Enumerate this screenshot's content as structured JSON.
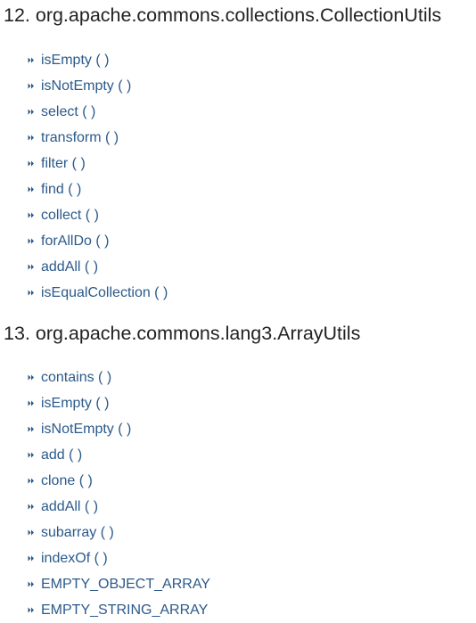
{
  "sections": [
    {
      "title": "12. org.apache.commons.collections.CollectionUtils",
      "items": [
        {
          "label": "isEmpty ( )"
        },
        {
          "label": "isNotEmpty ( )"
        },
        {
          "label": "select ( )"
        },
        {
          "label": "transform ( )"
        },
        {
          "label": "filter ( )"
        },
        {
          "label": "find ( )"
        },
        {
          "label": "collect ( )"
        },
        {
          "label": "forAllDo ( )"
        },
        {
          "label": "addAll ( )"
        },
        {
          "label": "isEqualCollection ( )"
        }
      ]
    },
    {
      "title": "13. org.apache.commons.lang3.ArrayUtils",
      "items": [
        {
          "label": "contains ( )"
        },
        {
          "label": "isEmpty ( )"
        },
        {
          "label": "isNotEmpty ( )"
        },
        {
          "label": "add ( )"
        },
        {
          "label": "clone ( )"
        },
        {
          "label": "addAll ( )"
        },
        {
          "label": "subarray ( )"
        },
        {
          "label": "indexOf ( )"
        },
        {
          "label": "EMPTY_OBJECT_ARRAY"
        },
        {
          "label": "EMPTY_STRING_ARRAY"
        }
      ]
    }
  ],
  "bullet_icon": "double-chevron-right-icon",
  "colors": {
    "link": "#2b5a8a",
    "heading": "#222222",
    "bullet": "#2b5a8a"
  }
}
